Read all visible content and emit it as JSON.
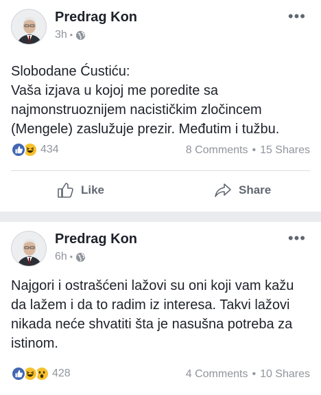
{
  "posts": [
    {
      "author": "Predrag Kon",
      "time": "3h",
      "body": [
        "Slobodane Ćustiću:",
        "Vaša izjava u kojoj me poredite sa",
        "najmonstruoznijem nacističkim zločincem",
        "(Mengele) zaslužuje prezir. Međutim i tužbu."
      ],
      "reaction_count": "434",
      "reactions": [
        "like-icon",
        "haha-icon"
      ],
      "comments": "8 Comments",
      "shares": "15 Shares",
      "like_label": "Like",
      "share_label": "Share"
    },
    {
      "author": "Predrag Kon",
      "time": "6h",
      "body": [
        "Najgori i ostrašćeni lažovi su oni koji vam kažu",
        "da lažem i da to radim iz interesa. Takvi lažovi",
        "nikada neće shvatiti šta je nasušna potreba za",
        "istinom."
      ],
      "reaction_count": "428",
      "reactions": [
        "like-icon",
        "haha-icon",
        "wow-icon"
      ],
      "comments": "4 Comments",
      "shares": "10 Shares"
    }
  ],
  "colors": {
    "like_blue": "#4267b2",
    "reaction_yellow": "#f7c12d",
    "secondary_text": "#90949c"
  }
}
